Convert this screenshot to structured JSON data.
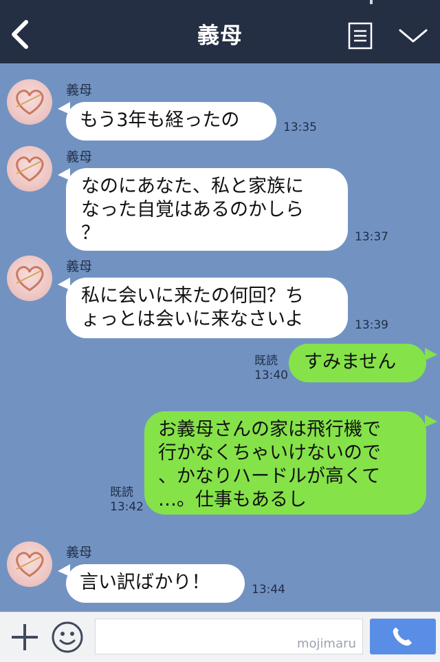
{
  "header": {
    "title": "義母",
    "icons": [
      "back-chevron-icon",
      "menu-list-icon",
      "chevron-down-icon"
    ]
  },
  "messages": [
    {
      "from": "them",
      "sender": "義母",
      "text": "もう3年も経ったの",
      "time": "13:35"
    },
    {
      "from": "them",
      "sender": "義母",
      "text": "なのにあなた、私と家族に\nなった自覚はあるのかしら\n？",
      "time": "13:37"
    },
    {
      "from": "them",
      "sender": "義母",
      "text": "私に会いに来たの何回？ち\nょっとは会いに来なさいよ",
      "time": "13:39"
    },
    {
      "from": "me",
      "read": "既読",
      "text": "すみません",
      "time": "13:40"
    },
    {
      "from": "me",
      "read": "既読",
      "text": "お義母さんの家は飛行機で\n行かなくちゃいけないので\n、かなりハードルが高くて\n…。仕事もあるし",
      "time": "13:42"
    },
    {
      "from": "them",
      "sender": "義母",
      "text": "言い訳ばかり！",
      "time": "13:44"
    }
  ],
  "input_bar": {
    "placeholder": "",
    "watermark": "mojimaru",
    "icons": [
      "plus-icon",
      "emoji-icon",
      "phone-icon"
    ]
  },
  "colors": {
    "header_bg": "#252f43",
    "chat_bg": "#7293c2",
    "incoming_bubble": "#ffffff",
    "outgoing_bubble": "#85e249",
    "call_button": "#5a8ee6"
  }
}
